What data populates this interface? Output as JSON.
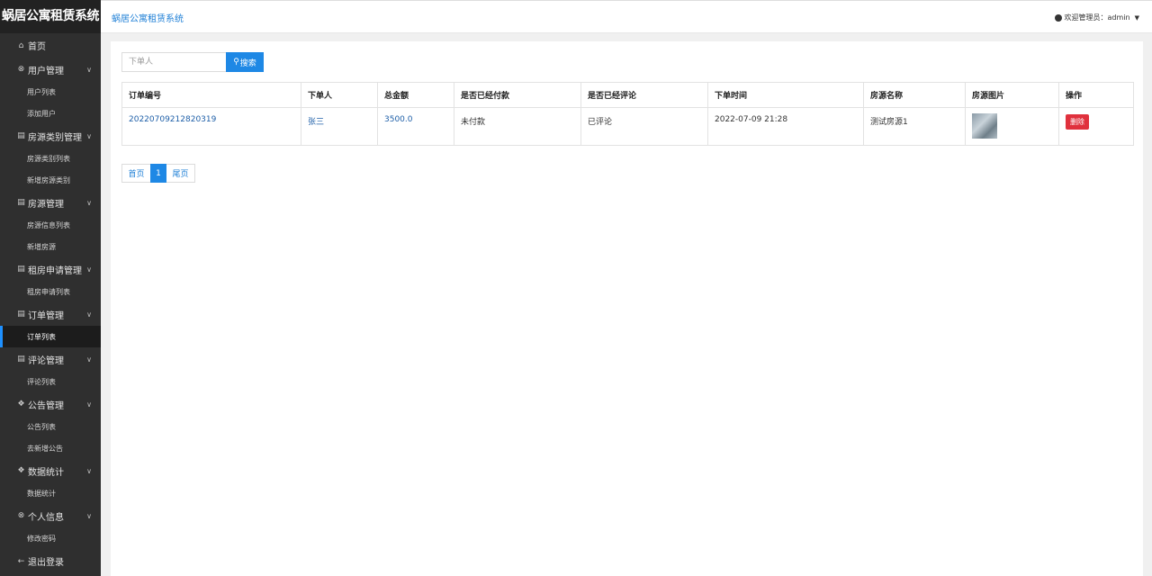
{
  "app": {
    "brand": "蜗居公寓租赁系统"
  },
  "sidebar": {
    "home": {
      "label": "首页",
      "icon": "home-icon"
    },
    "groups": [
      {
        "label": "用户管理",
        "items": [
          "用户列表",
          "添加用户"
        ]
      },
      {
        "label": "房源类别管理",
        "items": [
          "房源类别列表",
          "新增房源类别"
        ]
      },
      {
        "label": "房源管理",
        "items": [
          "房源信息列表",
          "新增房源"
        ]
      },
      {
        "label": "租房申请管理",
        "items": [
          "租房申请列表"
        ]
      },
      {
        "label": "订单管理",
        "items": [
          "订单列表"
        ]
      },
      {
        "label": "评论管理",
        "items": [
          "评论列表"
        ]
      },
      {
        "label": "公告管理",
        "items": [
          "公告列表",
          "去新增公告"
        ]
      },
      {
        "label": "数据统计",
        "items": [
          "数据统计"
        ]
      },
      {
        "label": "个人信息",
        "items": [
          "修改密码"
        ]
      }
    ],
    "logout": {
      "label": "退出登录",
      "icon": "arrow-left-icon"
    },
    "active_item": "订单列表"
  },
  "topbar": {
    "breadcrumb": "蜗居公寓租赁系统",
    "welcome": "欢迎管理员：admin"
  },
  "search": {
    "placeholder": "下单人",
    "button_label": "搜索"
  },
  "table": {
    "headers": [
      "订单编号",
      "下单人",
      "总金额",
      "是否已经付款",
      "是否已经评论",
      "下单时间",
      "房源名称",
      "房源图片",
      "操作"
    ],
    "rows": [
      {
        "order_no": "20220709212820319",
        "buyer": "张三",
        "amount": "3500.0",
        "paid": "未付款",
        "commented": "已评论",
        "time": "2022-07-09 21:28",
        "house": "测试房源1",
        "action": "删除"
      }
    ]
  },
  "pager": {
    "first": "首页",
    "current": "1",
    "last": "尾页"
  },
  "colors": {
    "sidebar_bg": "#2f2f2f",
    "accent": "#1e88e5",
    "danger": "#e0313d"
  }
}
